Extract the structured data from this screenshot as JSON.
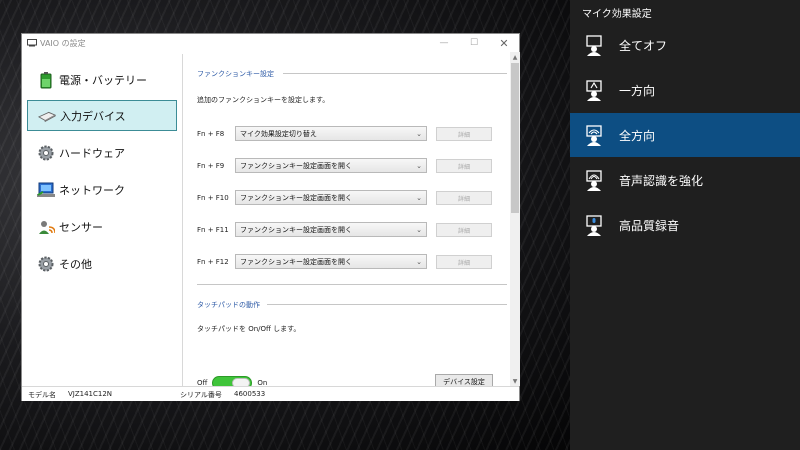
{
  "window": {
    "title": "VAIO の設定",
    "controls": {
      "minimize": "—",
      "maximize": "☐",
      "close": "✕"
    }
  },
  "sidebar": {
    "items": [
      {
        "label": "電源・バッテリー",
        "icon": "battery-icon"
      },
      {
        "label": "入力デバイス",
        "icon": "mouse-icon",
        "active": true
      },
      {
        "label": "ハードウェア",
        "icon": "gear-icon"
      },
      {
        "label": "ネットワーク",
        "icon": "network-icon"
      },
      {
        "label": "センサー",
        "icon": "sensor-icon"
      },
      {
        "label": "その他",
        "icon": "gear-icon"
      }
    ]
  },
  "function_keys": {
    "heading": "ファンクションキー設定",
    "description": "追加のファンクションキーを設定します。",
    "detail_label": "詳細",
    "rows": [
      {
        "key": "Fn + F8",
        "value": "マイク効果設定切り替え"
      },
      {
        "key": "Fn + F9",
        "value": "ファンクションキー設定画面を開く"
      },
      {
        "key": "Fn + F10",
        "value": "ファンクションキー設定画面を開く"
      },
      {
        "key": "Fn + F11",
        "value": "ファンクションキー設定画面を開く"
      },
      {
        "key": "Fn + F12",
        "value": "ファンクションキー設定画面を開く"
      }
    ]
  },
  "touchpad": {
    "heading": "タッチパッドの動作",
    "description": "タッチパッドを On/Off します。",
    "off_label": "Off",
    "on_label": "On",
    "toggle_state": "on",
    "device_settings_label": "デバイス設定"
  },
  "status": {
    "model_label": "モデル名",
    "model_value": "VJZ141C12N",
    "serial_label": "シリアル番号",
    "serial_value": "4600533"
  },
  "flyout": {
    "title": "マイク効果設定",
    "items": [
      {
        "label": "全てオフ",
        "icon": "mic-off-icon"
      },
      {
        "label": "一方向",
        "icon": "mic-one-direction-icon"
      },
      {
        "label": "全方向",
        "icon": "mic-omni-icon",
        "selected": true
      },
      {
        "label": "音声認識を強化",
        "icon": "mic-voice-recognition-icon"
      },
      {
        "label": "高品質録音",
        "icon": "mic-hq-recording-icon"
      }
    ]
  },
  "colors": {
    "accent_selected": "#0d4e83",
    "sidebar_active_bg": "#d1eff2",
    "section_heading": "#2d5aa6",
    "toggle_on": "#3fc43a"
  }
}
